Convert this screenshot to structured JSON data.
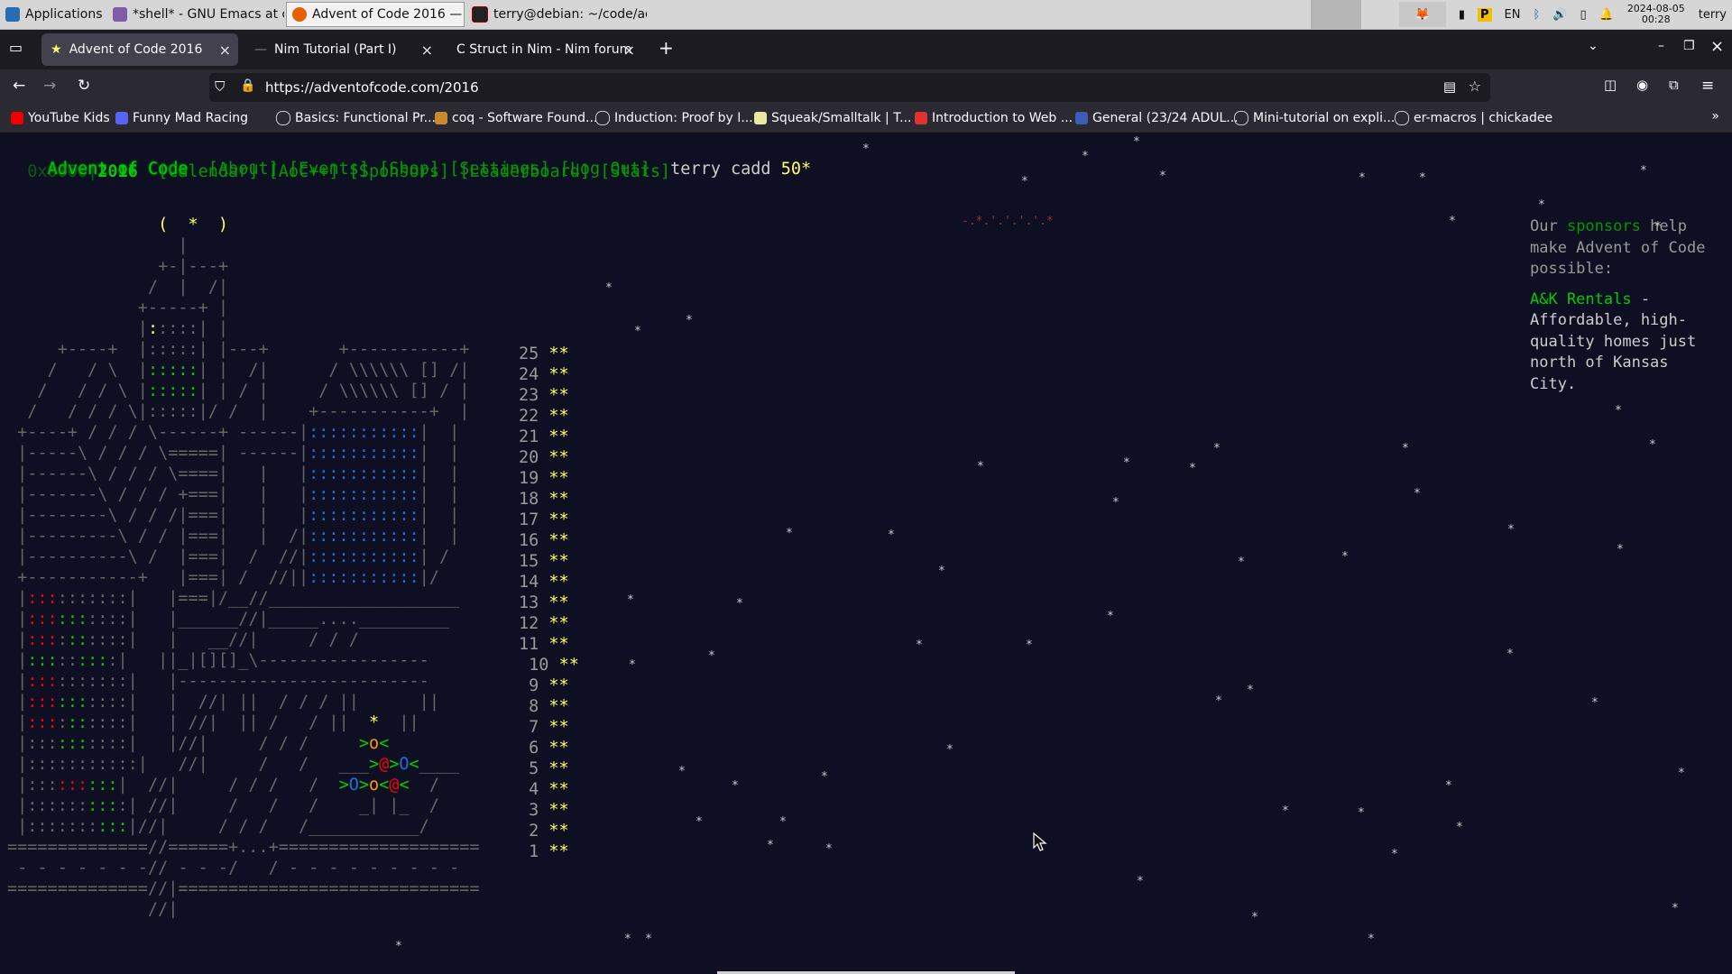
{
  "taskbar": {
    "apps_label": "Applications",
    "tasks": [
      "*shell* - GNU Emacs at de...",
      "Advent of Code 2016 — ...",
      "terry@debian: ~/code/ad..."
    ],
    "tray": {
      "lang": "EN",
      "clock_date": "2024-08-05",
      "clock_time": "00:28",
      "user": "terry"
    }
  },
  "browser": {
    "tabs": [
      {
        "label": "Advent of Code 2016",
        "active": true
      },
      {
        "label": "Nim Tutorial (Part I)",
        "active": false
      },
      {
        "label": "C Struct in Nim - Nim forum",
        "active": false
      }
    ],
    "new_tab": "+",
    "url": "https://adventofcode.com/2016",
    "bookmarks": [
      "YouTube Kids",
      "Funny Mad Racing",
      "Basics: Functional Pr...",
      "coq - Software Found...",
      "Induction: Proof by I...",
      "Squeak/Smalltalk | T...",
      "Introduction to Web ...",
      "General (23/24 ADUL...",
      "Mini-tutorial on expli...",
      "er-macros | chickadee"
    ]
  },
  "aoc": {
    "title": "Advent of Code",
    "year_prefix": "0x0000|",
    "year": "2016",
    "nav_row1": [
      "[About]",
      "[Events]",
      "[Shop]",
      "[Settings]",
      "[Log Out]"
    ],
    "nav_row2": [
      "[Calendar]",
      "[AoC++]",
      "[Sponsors]",
      "[Leaderboard]",
      "[Stats]"
    ],
    "user": "terry cadd",
    "stars": "50*",
    "days": [
      "25",
      "24",
      "23",
      "22",
      "21",
      "20",
      "19",
      "18",
      "17",
      "16",
      "15",
      "14",
      "13",
      "12",
      "11",
      "10",
      "9",
      "8",
      "7",
      "6",
      "5",
      "4",
      "3",
      "2",
      "1"
    ],
    "day_stars": "**",
    "sponsor_intro_1": "Our ",
    "sponsor_link": "sponsors",
    "sponsor_intro_2": " help make Advent of Code possible:",
    "sponsor_name": "A&K Rentals",
    "sponsor_text": " - Affordable, high-quality homes just north of Kansas City."
  },
  "colors": {
    "page_bg": "#0f0f23",
    "aoc_green": "#00cc00",
    "aoc_gold": "#ffff66",
    "firefox_dark": "#2b2a33"
  }
}
